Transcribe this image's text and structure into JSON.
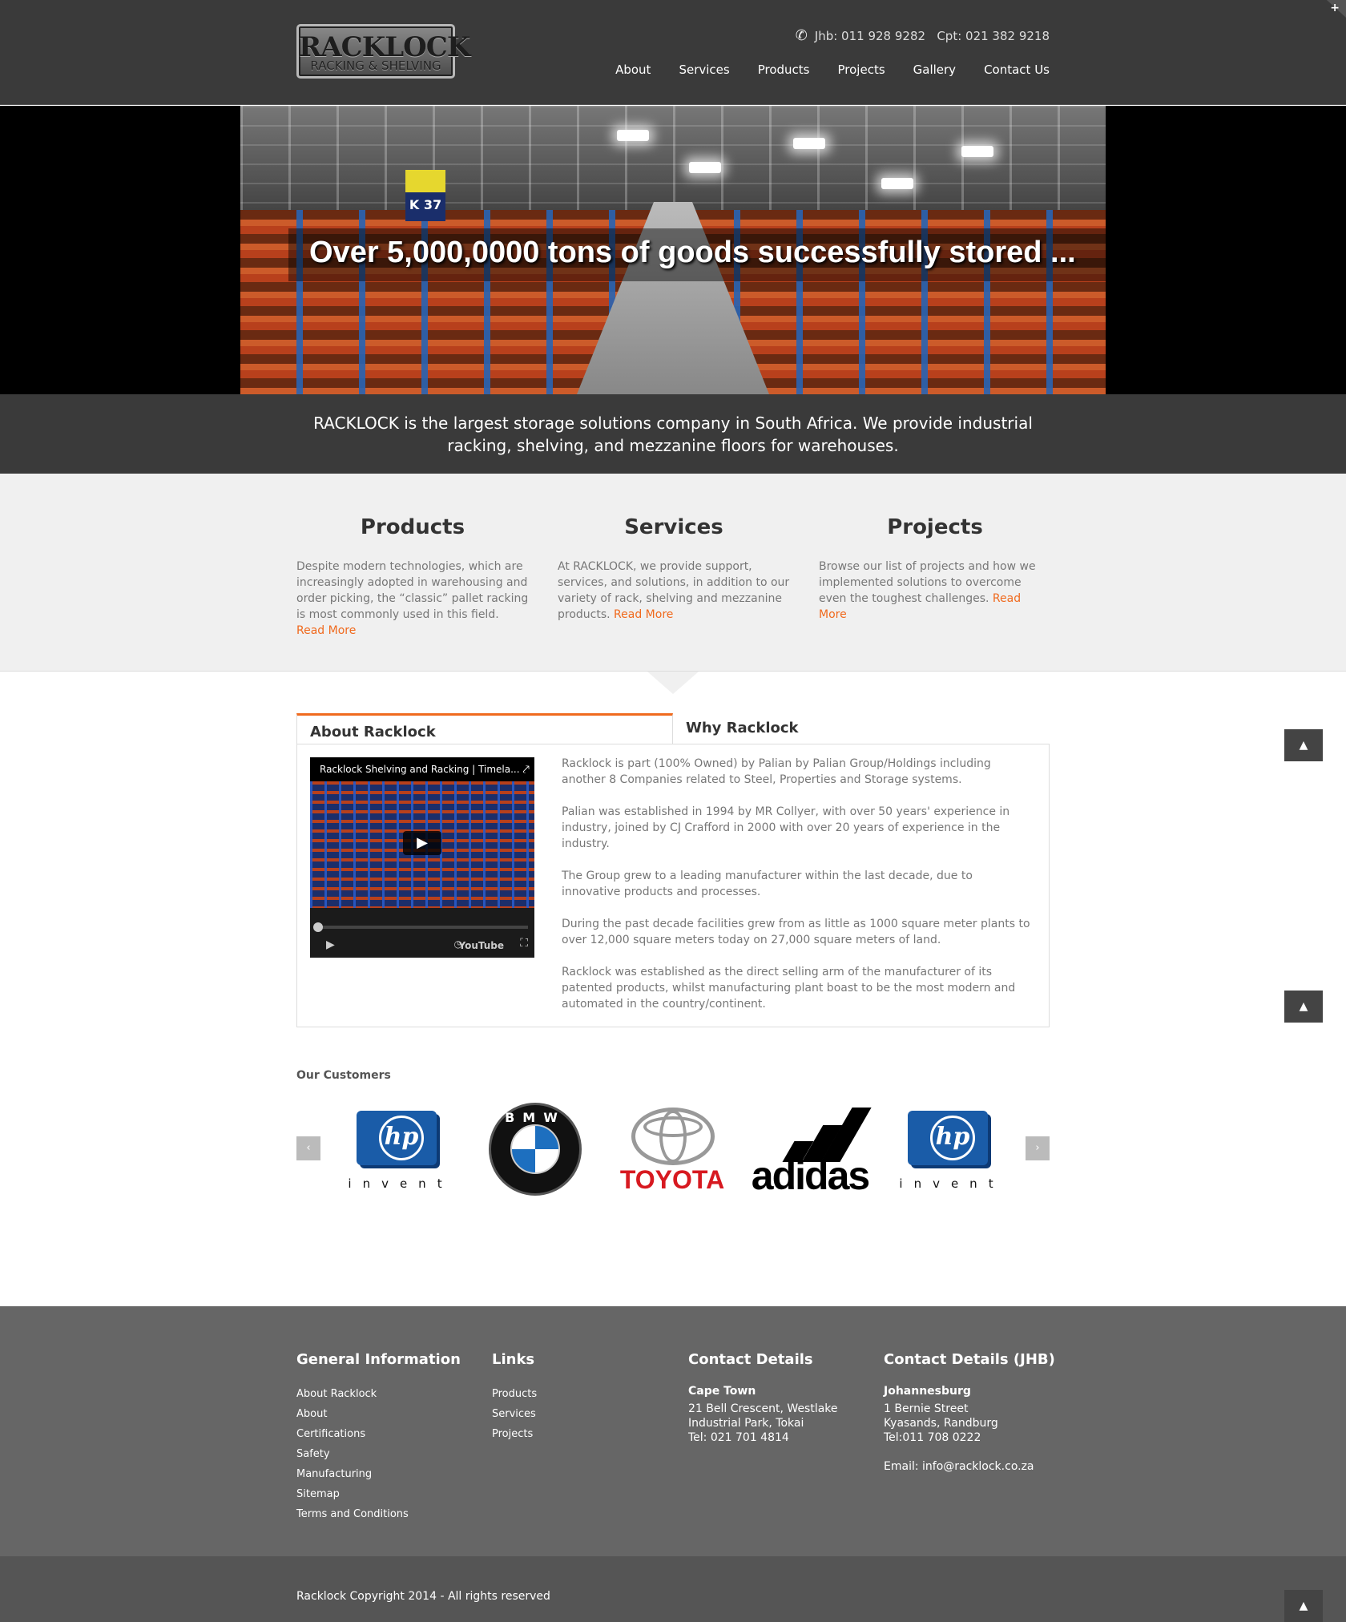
{
  "header": {
    "logo_line1": "RACKLOCK",
    "logo_line2": "RACKING & SHELVING",
    "phone": "Jhb: 011 928 9282   Cpt: 021 382 9218",
    "nav": [
      "About",
      "Services",
      "Products",
      "Projects",
      "Gallery",
      "Contact Us"
    ]
  },
  "hero": {
    "caption": "Over 5,000,0000 tons of goods successfully stored ..."
  },
  "tagline": "RACKLOCK is the largest storage solutions company in South Africa. We provide industrial racking, shelving, and mezzanine floors for warehouses.",
  "columns": [
    {
      "title": "Products",
      "text": "Despite modern technologies, which are increasingly adopted in warehousing and order picking, the “classic” pallet racking is most commonly used in this field.",
      "link": "Read More"
    },
    {
      "title": "Services",
      "text": "At RACKLOCK, we provide support, services, and solutions, in addition to our variety of rack, shelving and mezzanine products.",
      "link": "Read More"
    },
    {
      "title": "Projects",
      "text": "Browse our list of projects and how we implemented solutions to overcome even the toughest challenges.",
      "link": "Read More"
    }
  ],
  "tabs": {
    "active": "About Racklock",
    "inactive": "Why Racklock"
  },
  "video": {
    "title": "Racklock Shelving and Racking | Timela...",
    "brand": "YouTube"
  },
  "about_paragraphs": [
    "Racklock is part (100% Owned) by Palian by Palian Group/Holdings including another 8 Companies related to Steel, Properties and Storage systems.",
    "Palian was established in 1994 by MR Collyer, with over 50 years' experience in industry, joined by CJ Crafford in 2000 with over 20 years of experience in the industry.",
    "The Group grew to a leading manufacturer within the last decade, due to innovative products and processes.",
    "During the past decade facilities grew from as little as 1000 square meter plants to over 12,000 square meters today on 27,000 square meters of land.",
    "Racklock was established as the direct selling arm of the manufacturer of its patented products, whilst manufacturing plant boast to be the most modern and automated in the country/continent."
  ],
  "customers": {
    "title": "Our Customers",
    "logos": [
      {
        "name": "hp",
        "text": "hp",
        "sub": "invent"
      },
      {
        "name": "bmw",
        "text": "BMW"
      },
      {
        "name": "toyota",
        "text": "TOYOTA"
      },
      {
        "name": "adidas",
        "text": "adidas"
      },
      {
        "name": "hp",
        "text": "hp",
        "sub": "invent"
      }
    ]
  },
  "footer": {
    "general": {
      "title": "General Information",
      "links": [
        "About Racklock",
        "About",
        "Certifications",
        "Safety",
        "Manufacturing",
        "Sitemap",
        "Terms and Conditions"
      ]
    },
    "links": {
      "title": "Links",
      "links": [
        "Products",
        "Services",
        "Projects"
      ]
    },
    "contact_cpt": {
      "title": "Contact Details",
      "city": "Cape Town",
      "lines": [
        "21 Bell Crescent, Westlake",
        "Industrial Park, Tokai",
        "Tel: 021 701 4814"
      ]
    },
    "contact_jhb": {
      "title": "Contact Details (JHB)",
      "city": "Johannesburg",
      "lines": [
        "1 Bernie Street",
        "Kyasands, Randburg",
        "Tel:011 708 0222"
      ],
      "email": "Email: info@racklock.co.za"
    },
    "copyright": "Racklock Copyright 2014 - All rights reserved"
  },
  "colors": {
    "accent": "#f06a1e",
    "header_bg": "#3a3a3a",
    "footer_bg": "#666666"
  }
}
